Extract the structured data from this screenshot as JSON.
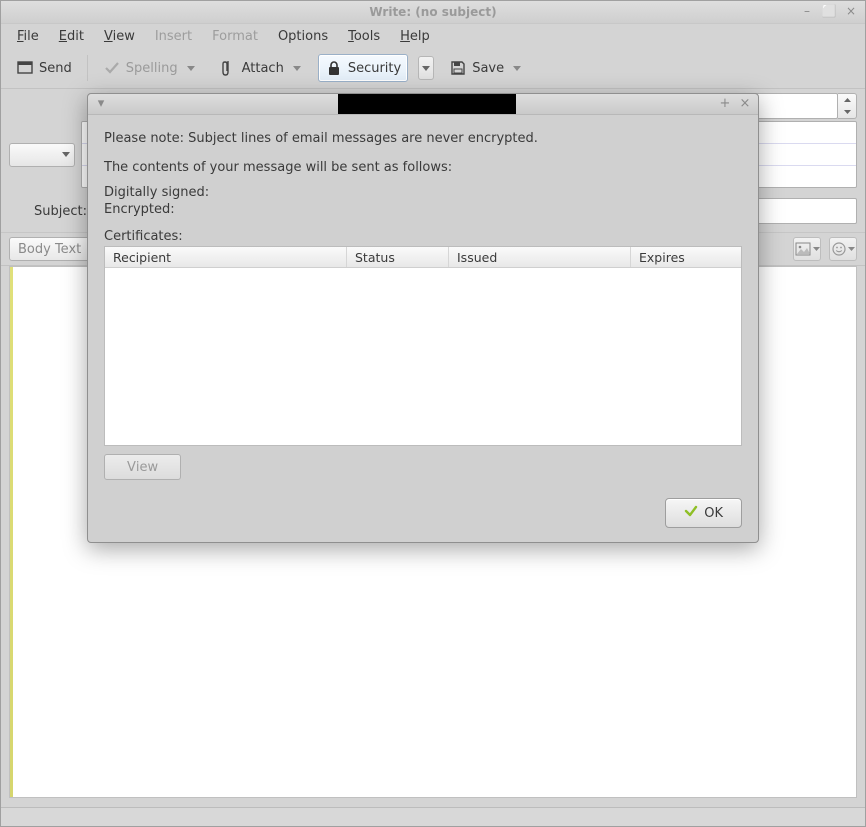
{
  "window": {
    "title": "Write: (no subject)",
    "controls": {
      "min": "–",
      "max": "⬜",
      "close": "×"
    }
  },
  "menubar": {
    "file": "File",
    "edit": "Edit",
    "view": "View",
    "insert": "Insert",
    "format": "Format",
    "options": "Options",
    "tools": "Tools",
    "help": "Help"
  },
  "toolbar": {
    "send": "Send",
    "spelling": "Spelling",
    "attach": "Attach",
    "security": "Security",
    "save": "Save"
  },
  "header_labels": {
    "subject": "Su"
  },
  "format_bar": {
    "style": "Body Text"
  },
  "modal": {
    "note": "Please note: Subject lines of email messages are never encrypted.",
    "contents": "The contents of your message will be sent as follows:",
    "signed": "Digitally signed:",
    "encrypted": "Encrypted:",
    "certificates": "Certificates:",
    "columns": {
      "recipient": "Recipient",
      "status": "Status",
      "issued": "Issued",
      "expires": "Expires"
    },
    "view_btn": "View",
    "ok_btn": "OK",
    "title_controls": {
      "expand": "+",
      "close": "×",
      "menu": "▾"
    }
  }
}
